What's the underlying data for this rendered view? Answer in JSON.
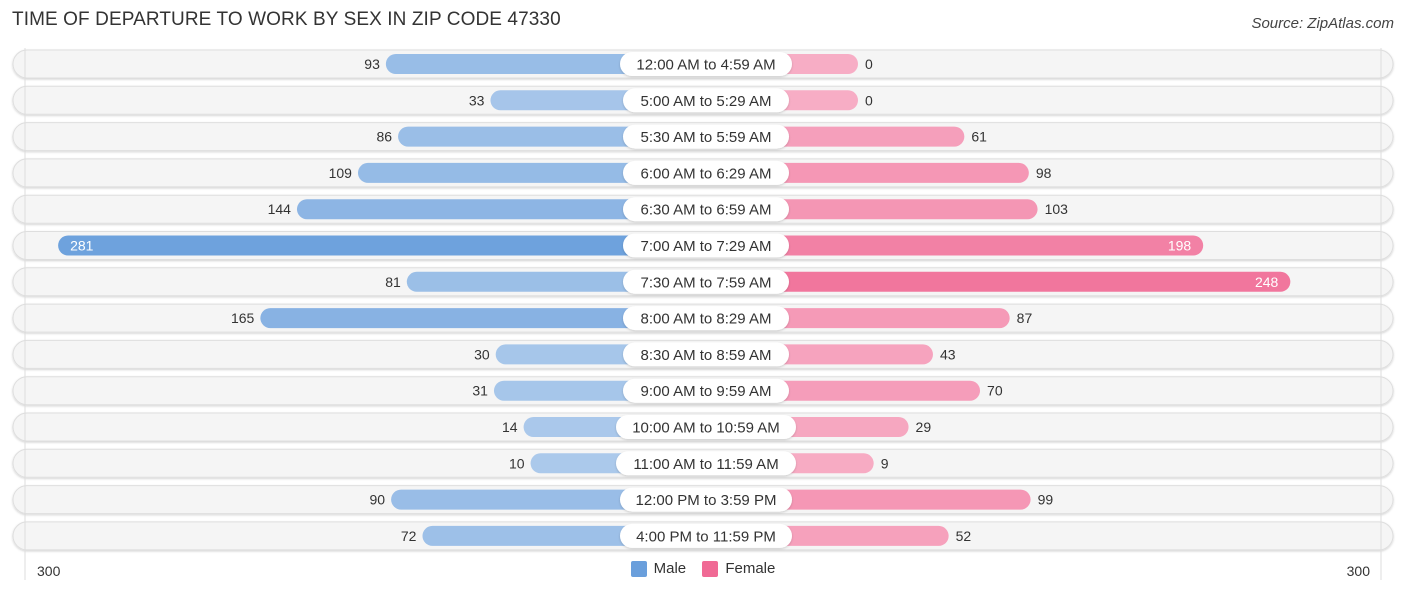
{
  "chart_data": {
    "type": "bar",
    "orientation": "horizontal-diverging",
    "title": "TIME OF DEPARTURE TO WORK BY SEX IN ZIP CODE 47330",
    "source": "Source: ZipAtlas.com",
    "categories": [
      "12:00 AM to 4:59 AM",
      "5:00 AM to 5:29 AM",
      "5:30 AM to 5:59 AM",
      "6:00 AM to 6:29 AM",
      "6:30 AM to 6:59 AM",
      "7:00 AM to 7:29 AM",
      "7:30 AM to 7:59 AM",
      "8:00 AM to 8:29 AM",
      "8:30 AM to 8:59 AM",
      "9:00 AM to 9:59 AM",
      "10:00 AM to 10:59 AM",
      "11:00 AM to 11:59 AM",
      "12:00 PM to 3:59 PM",
      "4:00 PM to 11:59 PM"
    ],
    "series": [
      {
        "name": "Male",
        "side": "left",
        "color": "#6a9fdc",
        "values": [
          93,
          33,
          86,
          109,
          144,
          281,
          81,
          165,
          30,
          31,
          14,
          10,
          90,
          72
        ]
      },
      {
        "name": "Female",
        "side": "right",
        "color": "#f06a95",
        "values": [
          0,
          0,
          61,
          98,
          103,
          198,
          248,
          87,
          43,
          70,
          29,
          9,
          99,
          52
        ]
      }
    ],
    "axis": {
      "left_max_label": "300",
      "right_max_label": "300",
      "range": [
        0,
        300
      ]
    },
    "legend": {
      "placement": "bottom-center",
      "entries": [
        "Male",
        "Female"
      ]
    },
    "grid": false
  }
}
